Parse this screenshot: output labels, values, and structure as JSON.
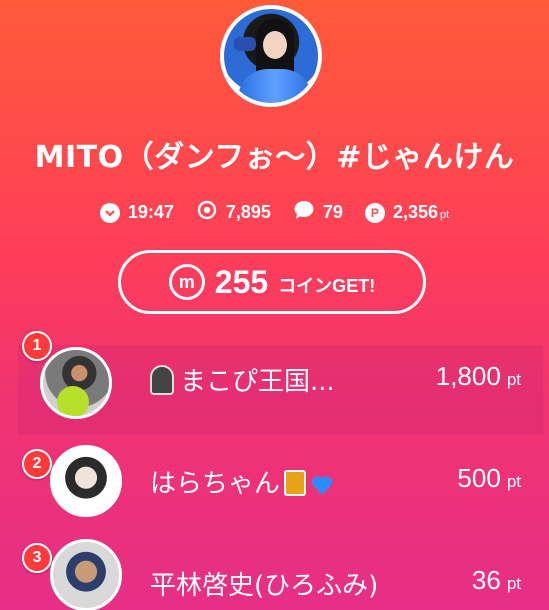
{
  "broadcast": {
    "title": "MITO（ダンフぉ〜）#じゃんけん",
    "stats": {
      "time": "19:47",
      "viewers": "7,895",
      "comments": "79",
      "points": "2,356",
      "points_unit": "pt"
    },
    "coin_button": {
      "amount": "255",
      "label": "コインGET!"
    }
  },
  "ranking": [
    {
      "rank": "1",
      "name": "まこぴ王国...",
      "score": "1,800",
      "unit": "pt"
    },
    {
      "rank": "2",
      "name": "はらちゃん",
      "score": "500",
      "unit": "pt"
    },
    {
      "rank": "3",
      "name": "平林啓史(ひろふみ)",
      "score": "36",
      "unit": "pt"
    }
  ],
  "colors": {
    "accent": "#ff4a4f",
    "badge": "#ff3a3a",
    "heart": "#2e8bff"
  }
}
